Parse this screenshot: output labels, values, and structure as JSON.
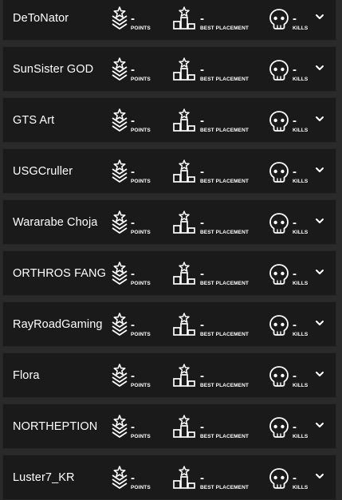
{
  "labels": {
    "points": "POINTS",
    "best_placement": "BEST PLACEMENT",
    "kills": "KILLS"
  },
  "players": [
    {
      "name": "DeToNator",
      "points": "-",
      "best_placement": "-",
      "kills": "-"
    },
    {
      "name": "SunSister GOD",
      "points": "-",
      "best_placement": "-",
      "kills": "-"
    },
    {
      "name": "GTS Art",
      "points": "-",
      "best_placement": "-",
      "kills": "-"
    },
    {
      "name": "USGCruller",
      "points": "-",
      "best_placement": "-",
      "kills": "-"
    },
    {
      "name": "Wararabe Choja",
      "points": "-",
      "best_placement": "-",
      "kills": "-"
    },
    {
      "name": "ORTHROS FANG",
      "points": "-",
      "best_placement": "-",
      "kills": "-"
    },
    {
      "name": "RayRoadGaming",
      "points": "-",
      "best_placement": "-",
      "kills": "-"
    },
    {
      "name": "Flora",
      "points": "-",
      "best_placement": "-",
      "kills": "-"
    },
    {
      "name": "NORTHEPTION",
      "points": "-",
      "best_placement": "-",
      "kills": "-"
    },
    {
      "name": "Luster7_KR",
      "points": "-",
      "best_placement": "-",
      "kills": "-"
    }
  ],
  "icons": {
    "points": "points-chevron-star-icon",
    "best_placement": "podium-icon",
    "kills": "skull-icon",
    "expand": "chevron-down-icon"
  }
}
